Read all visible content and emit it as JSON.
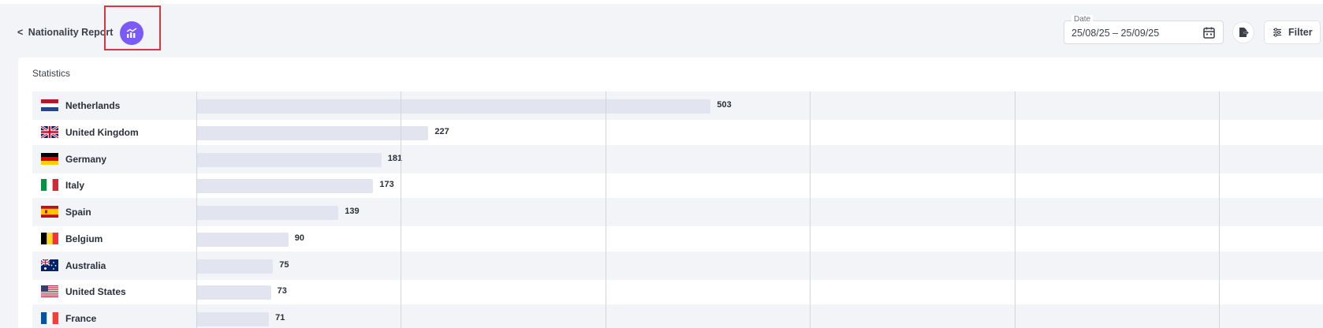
{
  "header": {
    "back_label": "Nationality Report",
    "back_chevron": "<",
    "chart_toggle_icon": "chart-icon",
    "date": {
      "label": "Date",
      "value": "25/08/25 – 25/09/25",
      "icon": "calendar-icon"
    },
    "export_icon": "export-icon",
    "filter": {
      "label": "Filter",
      "icon": "sliders-icon"
    }
  },
  "colors": {
    "accent": "#7a5af8",
    "highlight": "#d9373f",
    "bar": "#e2e4f0"
  },
  "card": {
    "title": "Statistics"
  },
  "chart_data": {
    "type": "bar",
    "orientation": "horizontal",
    "grid": true,
    "xlim": [
      0,
      1000
    ],
    "categories": [
      "Netherlands",
      "United Kingdom",
      "Germany",
      "Italy",
      "Spain",
      "Belgium",
      "Australia",
      "United States",
      "France"
    ],
    "flags": [
      "nl-flag",
      "gb-flag",
      "de-flag",
      "it-flag",
      "es-flag",
      "be-flag",
      "au-flag",
      "us-flag",
      "fr-flag"
    ],
    "values": [
      503,
      227,
      181,
      173,
      139,
      90,
      75,
      73,
      71
    ]
  }
}
